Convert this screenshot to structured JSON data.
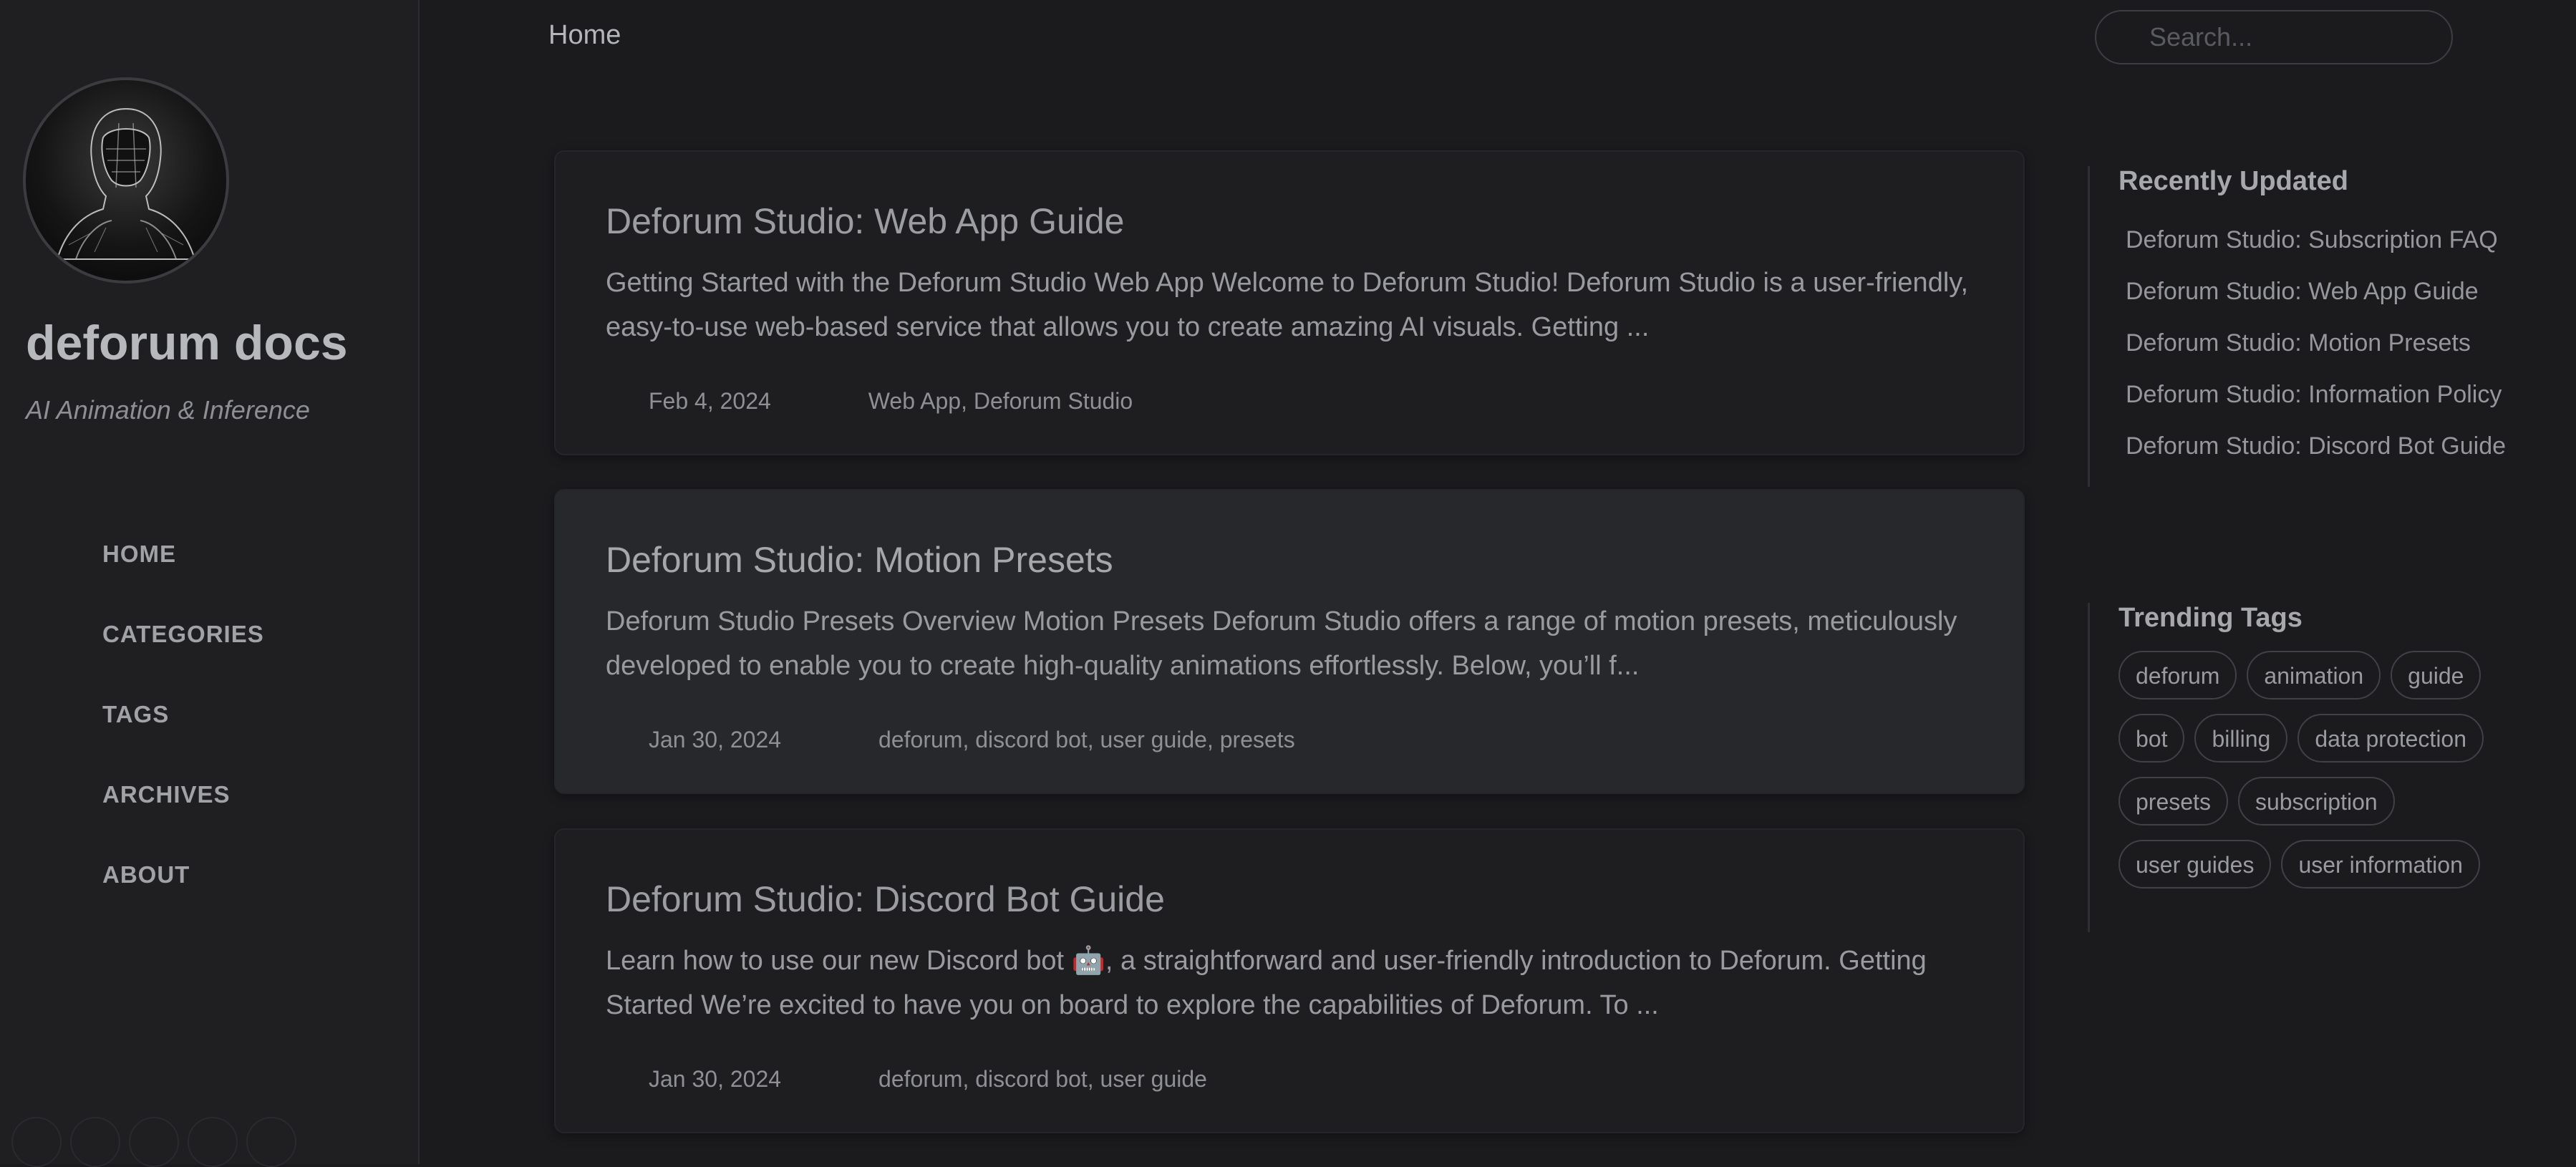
{
  "site": {
    "title": "deforum docs",
    "subtitle": "AI Animation & Inference"
  },
  "nav": {
    "items": [
      {
        "label": "HOME"
      },
      {
        "label": "CATEGORIES"
      },
      {
        "label": "TAGS"
      },
      {
        "label": "ARCHIVES"
      },
      {
        "label": "ABOUT"
      }
    ]
  },
  "topbar": {
    "title": "Home",
    "search_placeholder": "Search..."
  },
  "posts": [
    {
      "title": "Deforum Studio: Web App Guide",
      "excerpt": "Getting Started with the Deforum Studio Web App Welcome to Deforum Studio! Deforum Studio is a user-friendly, easy-to-use web-based service that allows you to create amazing AI visuals. Getting ...",
      "date": "Feb 4, 2024",
      "tags": "Web App, Deforum Studio"
    },
    {
      "title": "Deforum Studio: Motion Presets",
      "excerpt": "Deforum Studio Presets Overview Motion Presets Deforum Studio offers a range of motion presets, meticulously developed to enable you to create high-quality animations effortlessly. Below, you’ll f...",
      "date": "Jan 30, 2024",
      "tags": "deforum, discord bot, user guide, presets"
    },
    {
      "title": "Deforum Studio: Discord Bot Guide",
      "excerpt": "Learn how to use our new Discord bot 🤖, a straightforward and user-friendly introduction to Deforum. Getting Started We’re excited to have you on board to explore the capabilities of Deforum. To ...",
      "date": "Jan 30, 2024",
      "tags": "deforum, discord bot, user guide"
    }
  ],
  "recently_updated": {
    "heading": "Recently Updated",
    "items": [
      "Deforum Studio: Subscription FAQ",
      "Deforum Studio: Web App Guide",
      "Deforum Studio: Motion Presets",
      "Deforum Studio: Information Policy",
      "Deforum Studio: Discord Bot Guide"
    ]
  },
  "trending_tags": {
    "heading": "Trending Tags",
    "items": [
      "deforum",
      "animation",
      "guide",
      "bot",
      "billing",
      "data protection",
      "presets",
      "subscription",
      "user guides",
      "user information"
    ]
  }
}
